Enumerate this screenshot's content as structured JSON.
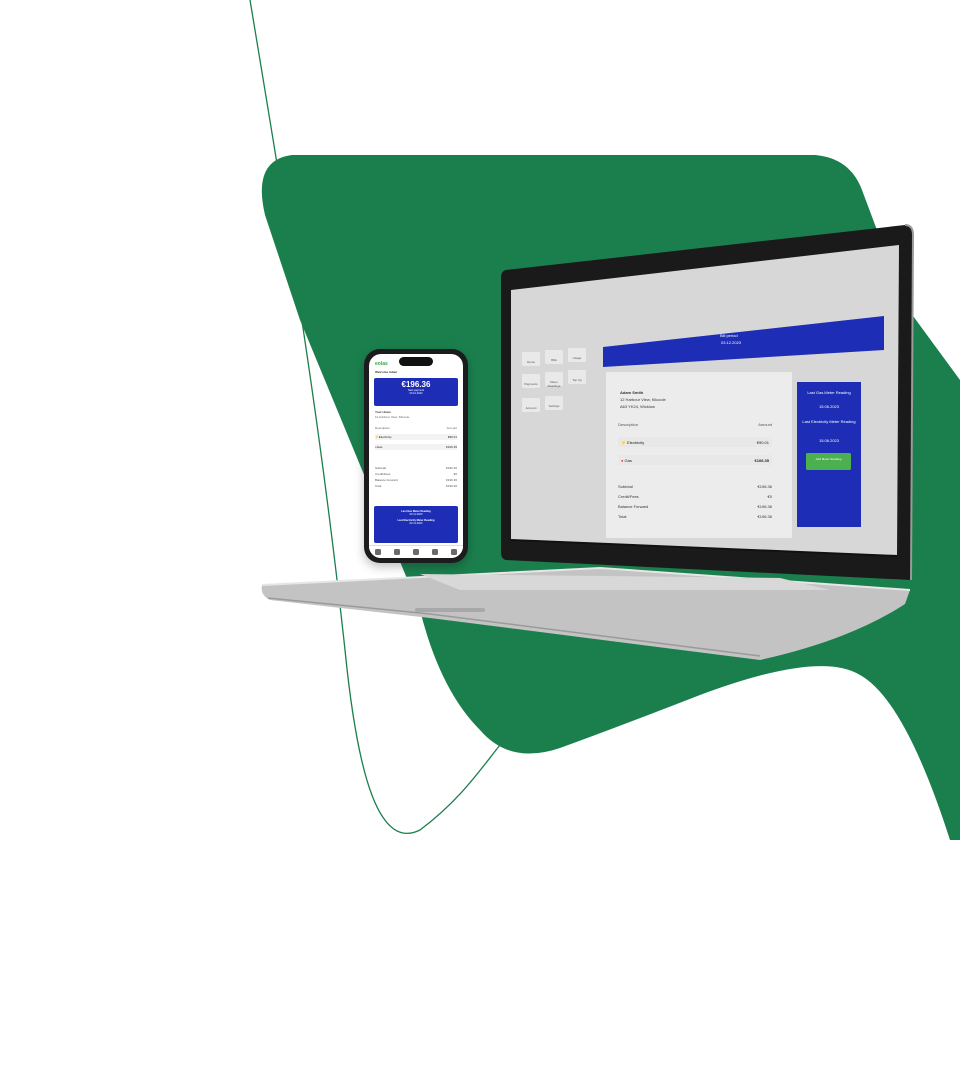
{
  "brand": {
    "green": "#1b7f4d",
    "blue": "#1d2db5",
    "button_green": "#4caf50"
  },
  "phone": {
    "logo": "eolas",
    "welcome": "Welcome Adam",
    "bill_amount": "€196.36",
    "bill_caption": "Next payment",
    "bill_date": "03.12.2023",
    "your_home": "Your Home",
    "address": "12 Harbour View, Kilcoole",
    "columns": [
      "Description",
      "Amount"
    ],
    "items": [
      {
        "name": "Electricity",
        "amount": "€90.01"
      },
      {
        "name": "Gas",
        "amount": "€106.35"
      }
    ],
    "summary": [
      {
        "label": "Subtotal",
        "value": "€196.36"
      },
      {
        "label": "Credit/Fees",
        "value": "€0"
      },
      {
        "label": "Balance Forward",
        "value": "€196.36"
      },
      {
        "label": "Total",
        "value": "€196.36"
      }
    ],
    "readings": [
      "Last Gas Meter Reading",
      "03.11.2023",
      "Last Electricity Meter Reading",
      "03.11.2023"
    ],
    "nav_icons": [
      "home-icon",
      "bill-icon",
      "usage-icon",
      "meter-icon",
      "settings-icon"
    ]
  },
  "laptop": {
    "banner_title": "Bill period",
    "banner_date": "03.12.2023",
    "nav_tiles": [
      "Home",
      "Bills",
      "Usage",
      "Payments",
      "Meter Readings",
      "Top Up",
      "Account",
      "Settings"
    ],
    "account_name": "Adam Smith",
    "address_line1": "12 Harbour View, Kilcoole",
    "address_line2": "A63 YK24, Wicklow",
    "columns": [
      "Description",
      "Amount"
    ],
    "items": [
      {
        "name": "Electricity",
        "amount": "€90.01"
      },
      {
        "name": "Gas",
        "amount": "€106.35"
      }
    ],
    "summary": [
      {
        "label": "Subtotal",
        "value": "€196.36"
      },
      {
        "label": "Credit/Fees",
        "value": "€0"
      },
      {
        "label": "Balance Forward",
        "value": "€196.36"
      },
      {
        "label": "Total",
        "value": "€196.36"
      }
    ],
    "side_card": {
      "gas_title": "Last Gas Meter Reading",
      "gas_date": "15.06.2023",
      "elec_title": "Last Electricity Meter Reading",
      "elec_date": "15.06.2023",
      "button_label": "Add Meter Reading"
    }
  }
}
